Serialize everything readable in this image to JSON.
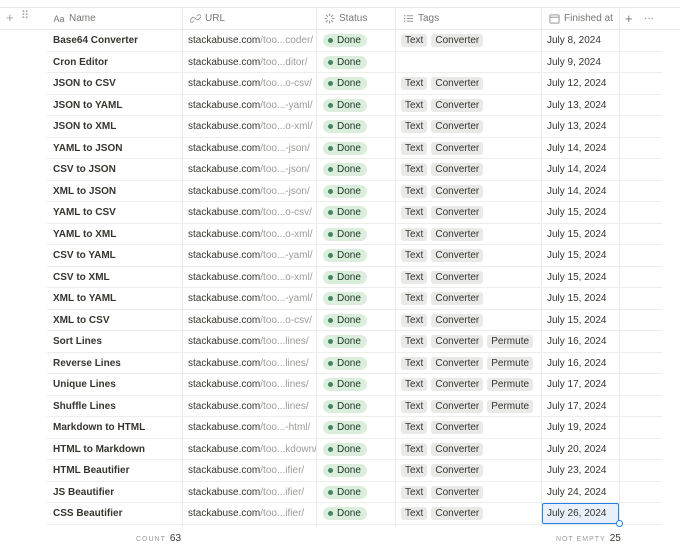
{
  "toolbar": {
    "add_icon": "plus-icon",
    "drag_icon": "drag-handle-icon"
  },
  "columns": [
    {
      "key": "name",
      "label": "Name",
      "icon": "text-property-icon"
    },
    {
      "key": "url",
      "label": "URL",
      "icon": "link-icon"
    },
    {
      "key": "status",
      "label": "Status",
      "icon": "status-spinner-icon"
    },
    {
      "key": "tags",
      "label": "Tags",
      "icon": "list-icon"
    },
    {
      "key": "finished_at",
      "label": "Finished at",
      "icon": "calendar-icon"
    }
  ],
  "header_actions": {
    "add_column": "+",
    "more": "···"
  },
  "rows": [
    {
      "name": "Base64 Converter",
      "url_host": "stackabuse.com",
      "url_rest": "/too...coder/",
      "status": "Done",
      "tags": [
        "Text",
        "Converter"
      ],
      "date": "July 8, 2024"
    },
    {
      "name": "Cron Editor",
      "url_host": "stackabuse.com",
      "url_rest": "/too...ditor/",
      "status": "Done",
      "tags": [],
      "date": "July 9, 2024"
    },
    {
      "name": "JSON to CSV",
      "url_host": "stackabuse.com",
      "url_rest": "/too...o-csv/",
      "status": "Done",
      "tags": [
        "Text",
        "Converter"
      ],
      "date": "July 12, 2024"
    },
    {
      "name": "JSON to YAML",
      "url_host": "stackabuse.com",
      "url_rest": "/too...-yaml/",
      "status": "Done",
      "tags": [
        "Text",
        "Converter"
      ],
      "date": "July 13, 2024"
    },
    {
      "name": "JSON to XML",
      "url_host": "stackabuse.com",
      "url_rest": "/too...o-xml/",
      "status": "Done",
      "tags": [
        "Text",
        "Converter"
      ],
      "date": "July 13, 2024"
    },
    {
      "name": "YAML to JSON",
      "url_host": "stackabuse.com",
      "url_rest": "/too...-json/",
      "status": "Done",
      "tags": [
        "Text",
        "Converter"
      ],
      "date": "July 14, 2024"
    },
    {
      "name": "CSV to JSON",
      "url_host": "stackabuse.com",
      "url_rest": "/too...-json/",
      "status": "Done",
      "tags": [
        "Text",
        "Converter"
      ],
      "date": "July 14, 2024"
    },
    {
      "name": "XML to JSON",
      "url_host": "stackabuse.com",
      "url_rest": "/too...-json/",
      "status": "Done",
      "tags": [
        "Text",
        "Converter"
      ],
      "date": "July 14, 2024"
    },
    {
      "name": "YAML to CSV",
      "url_host": "stackabuse.com",
      "url_rest": "/too...o-csv/",
      "status": "Done",
      "tags": [
        "Text",
        "Converter"
      ],
      "date": "July 15, 2024"
    },
    {
      "name": "YAML to XML",
      "url_host": "stackabuse.com",
      "url_rest": "/too...o-xml/",
      "status": "Done",
      "tags": [
        "Text",
        "Converter"
      ],
      "date": "July 15, 2024"
    },
    {
      "name": "CSV to YAML",
      "url_host": "stackabuse.com",
      "url_rest": "/too...-yaml/",
      "status": "Done",
      "tags": [
        "Text",
        "Converter"
      ],
      "date": "July 15, 2024"
    },
    {
      "name": "CSV to XML",
      "url_host": "stackabuse.com",
      "url_rest": "/too...o-xml/",
      "status": "Done",
      "tags": [
        "Text",
        "Converter"
      ],
      "date": "July 15, 2024"
    },
    {
      "name": "XML to YAML",
      "url_host": "stackabuse.com",
      "url_rest": "/too...-yaml/",
      "status": "Done",
      "tags": [
        "Text",
        "Converter"
      ],
      "date": "July 15, 2024"
    },
    {
      "name": "XML to CSV",
      "url_host": "stackabuse.com",
      "url_rest": "/too...o-csv/",
      "status": "Done",
      "tags": [
        "Text",
        "Converter"
      ],
      "date": "July 15, 2024"
    },
    {
      "name": "Sort Lines",
      "url_host": "stackabuse.com",
      "url_rest": "/too...lines/",
      "status": "Done",
      "tags": [
        "Text",
        "Converter",
        "Permute"
      ],
      "date": "July 16, 2024"
    },
    {
      "name": "Reverse Lines",
      "url_host": "stackabuse.com",
      "url_rest": "/too...lines/",
      "status": "Done",
      "tags": [
        "Text",
        "Converter",
        "Permute"
      ],
      "date": "July 16, 2024"
    },
    {
      "name": "Unique Lines",
      "url_host": "stackabuse.com",
      "url_rest": "/too...lines/",
      "status": "Done",
      "tags": [
        "Text",
        "Converter",
        "Permute"
      ],
      "date": "July 17, 2024"
    },
    {
      "name": "Shuffle Lines",
      "url_host": "stackabuse.com",
      "url_rest": "/too...lines/",
      "status": "Done",
      "tags": [
        "Text",
        "Converter",
        "Permute"
      ],
      "date": "July 17, 2024"
    },
    {
      "name": "Markdown to HTML",
      "url_host": "stackabuse.com",
      "url_rest": "/too...-html/",
      "status": "Done",
      "tags": [
        "Text",
        "Converter"
      ],
      "date": "July 19, 2024"
    },
    {
      "name": "HTML to Markdown",
      "url_host": "stackabuse.com",
      "url_rest": "/too...kdown/",
      "status": "Done",
      "tags": [
        "Text",
        "Converter"
      ],
      "date": "July 20, 2024"
    },
    {
      "name": "HTML Beautifier",
      "url_host": "stackabuse.com",
      "url_rest": "/too...ifier/",
      "status": "Done",
      "tags": [
        "Text",
        "Converter"
      ],
      "date": "July 23, 2024"
    },
    {
      "name": "JS Beautifier",
      "url_host": "stackabuse.com",
      "url_rest": "/too...ifier/",
      "status": "Done",
      "tags": [
        "Text",
        "Converter"
      ],
      "date": "July 24, 2024"
    },
    {
      "name": "CSS Beautifier",
      "url_host": "stackabuse.com",
      "url_rest": "/too...ifier/",
      "status": "Done",
      "tags": [
        "Text",
        "Converter"
      ],
      "date": "July 26, 2024",
      "selected": true
    }
  ],
  "footer": {
    "count_label": "COUNT",
    "count_value": "63",
    "not_empty_label": "NOT EMPTY",
    "not_empty_value": "25"
  },
  "colors": {
    "status_done_bg": "#dbeddb",
    "status_done_dot": "#448361",
    "tag_bg": "#e9e9e7",
    "selection": "#2383e2"
  }
}
